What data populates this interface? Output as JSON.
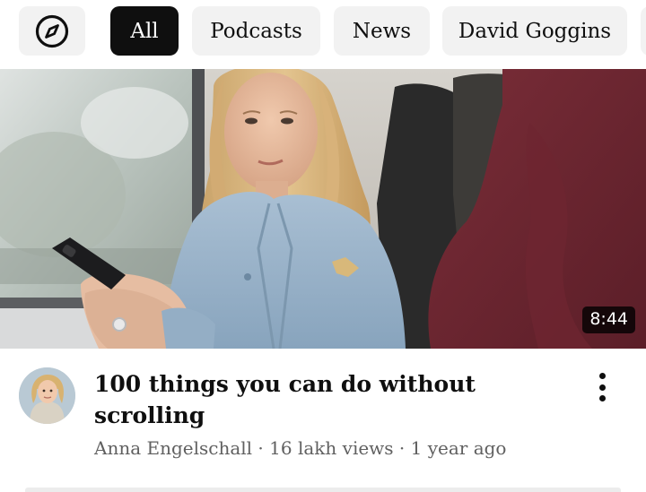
{
  "chips": {
    "explore_icon": "compass-icon",
    "items": [
      {
        "label": "All",
        "active": true
      },
      {
        "label": "Podcasts",
        "active": false
      },
      {
        "label": "News",
        "active": false
      },
      {
        "label": "David Goggins",
        "active": false
      },
      {
        "label": "",
        "active": false
      }
    ]
  },
  "video": {
    "duration": "8:44",
    "title": "100 things you can do without scrolling",
    "channel": "Anna Engelschall",
    "views": "16 lakh views",
    "age": "1 year ago",
    "meta_separator": " · ",
    "menu_icon": "more-vert-icon",
    "avatar_icon": "channel-avatar"
  },
  "colors": {
    "chip_active_bg": "#0f0f0f",
    "chip_bg": "#f2f2f2",
    "text_primary": "#0f0f0f",
    "text_secondary": "#606060",
    "duration_badge_bg": "#000000"
  }
}
